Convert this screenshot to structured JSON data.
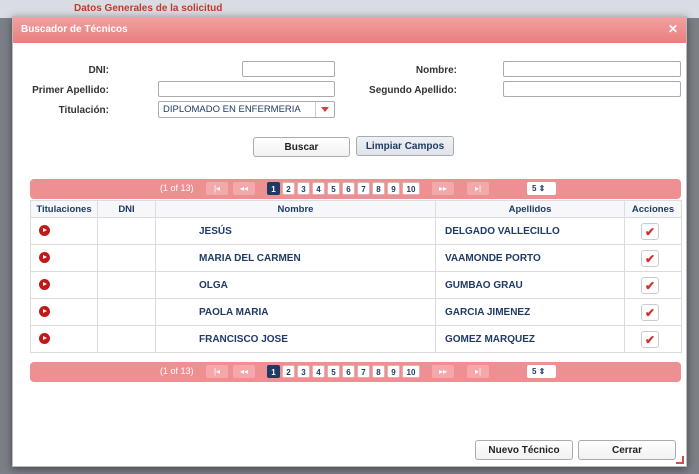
{
  "background": {
    "heading": "Datos Generales de la solicitud"
  },
  "dialog": {
    "title": "Buscador de Técnicos"
  },
  "form": {
    "dni_label": "DNI:",
    "nombre_label": "Nombre:",
    "primer_apellido_label": "Primer Apellido:",
    "segundo_apellido_label": "Segundo Apellido:",
    "titulacion_label": "Titulación:",
    "titulacion_value": "DIPLOMADO EN ENFERMERIA",
    "dni_value": "",
    "nombre_value": "",
    "primer_apellido_value": "",
    "segundo_apellido_value": ""
  },
  "buttons": {
    "buscar": "Buscar",
    "limpiar": "Limpiar Campos",
    "nuevo_tecnico": "Nuevo Técnico",
    "cerrar": "Cerrar"
  },
  "paginator": {
    "current": "(1 of 13)",
    "first": "|◂",
    "prev": "◂◂",
    "next": "▸▸",
    "last": "▸|",
    "pages": [
      "1",
      "2",
      "3",
      "4",
      "5",
      "6",
      "7",
      "8",
      "9",
      "10"
    ],
    "active_page": "1",
    "rows_per_page": "5"
  },
  "table": {
    "columns": {
      "titulaciones": "Titulaciones",
      "dni": "DNI",
      "nombre": "Nombre",
      "apellidos": "Apellidos",
      "acciones": "Acciones"
    },
    "rows": [
      {
        "dni": "",
        "nombre": "JESÚS",
        "apellidos": "DELGADO VALLECILLO"
      },
      {
        "dni": "",
        "nombre": "MARIA DEL CARMEN",
        "apellidos": "VAAMONDE PORTO"
      },
      {
        "dni": "",
        "nombre": "OLGA",
        "apellidos": "GUMBAO GRAU"
      },
      {
        "dni": "",
        "nombre": "PAOLA MARIA",
        "apellidos": "GARCIA JIMENEZ"
      },
      {
        "dni": "",
        "nombre": "FRANCISCO JOSE",
        "apellidos": "GOMEZ MARQUEZ"
      }
    ]
  },
  "icons": {
    "close": "close-icon",
    "view": "arrow-circle-icon",
    "select": "checkmark-icon",
    "dropdown": "chevron-down-icon"
  },
  "colors": {
    "accent": "#ee8f91",
    "title_bar": "#e97f7f",
    "text_primary": "#1f3a64",
    "danger": "#c41717"
  }
}
